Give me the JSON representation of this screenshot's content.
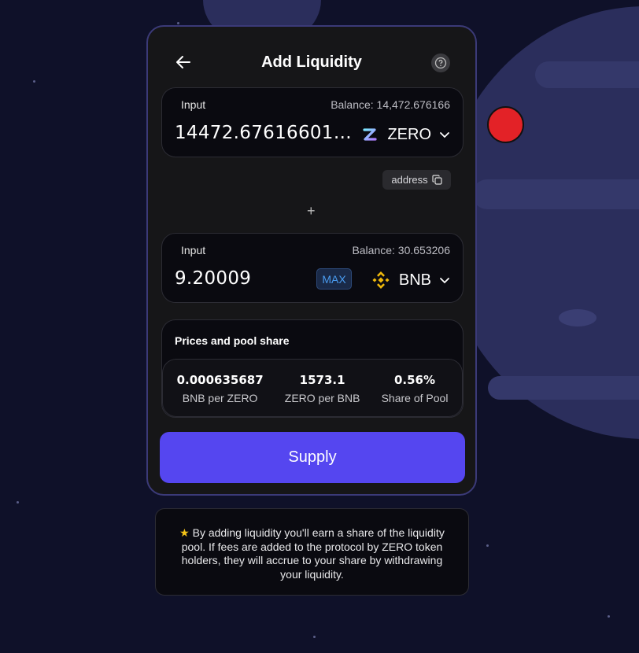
{
  "header": {
    "title": "Add Liquidity"
  },
  "input_a": {
    "label": "Input",
    "balance": "Balance: 14,472.676166",
    "amount": "14472.676166012...",
    "token": "ZERO",
    "address_label": "address"
  },
  "input_b": {
    "label": "Input",
    "balance": "Balance: 30.653206",
    "amount": "9.20009",
    "max_label": "MAX",
    "token": "BNB"
  },
  "plus_symbol": "+",
  "prices": {
    "title": "Prices and pool share",
    "items": [
      {
        "value": "0.000635687",
        "label": "BNB per ZERO"
      },
      {
        "value": "1573.1",
        "label": "ZERO per BNB"
      },
      {
        "value": "0.56%",
        "label": "Share of Pool"
      }
    ]
  },
  "supply_label": "Supply",
  "info": {
    "star": "★",
    "text": "By adding liquidity you'll earn a share of the liquidity pool. If fees are added to the protocol by ZERO token holders, they will accrue to your share by withdrawing your liquidity."
  },
  "colors": {
    "background": "#0f1129",
    "card": "#161618",
    "accent": "#5546f0",
    "card_border": "#3b3a78",
    "bnb": "#f0b90b",
    "star": "#f5c518"
  },
  "icons": [
    "back-arrow-icon",
    "help-icon",
    "zero-token-icon",
    "chevron-down-icon",
    "copy-icon",
    "bnb-token-icon",
    "star-icon"
  ]
}
